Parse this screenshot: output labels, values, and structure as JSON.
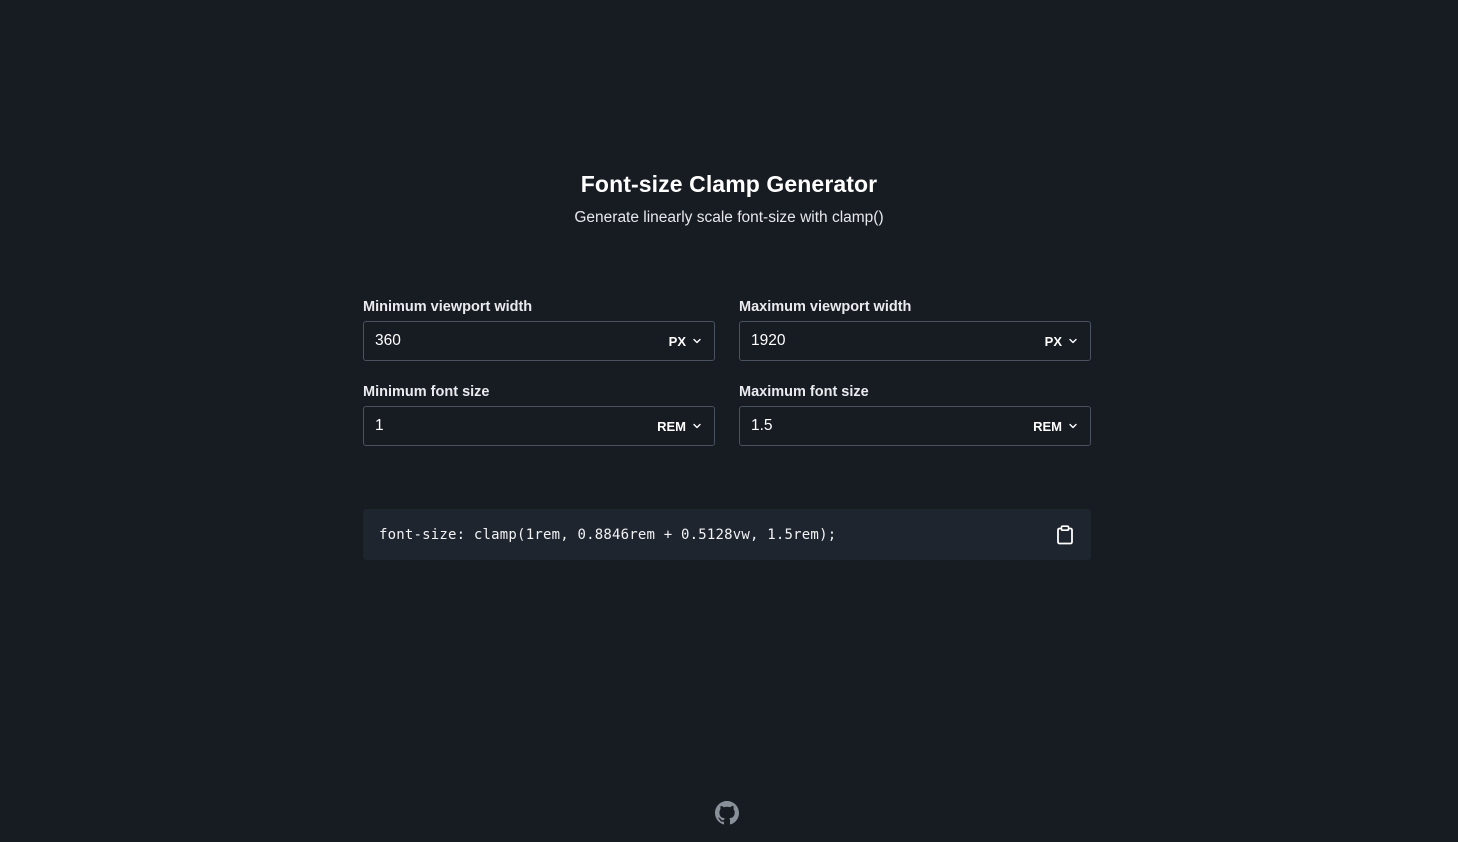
{
  "header": {
    "title": "Font-size Clamp Generator",
    "subtitle": "Generate linearly scale font-size with clamp()"
  },
  "fields": {
    "min_viewport": {
      "label": "Minimum viewport width",
      "value": "360",
      "unit": "PX"
    },
    "max_viewport": {
      "label": "Maximum viewport width",
      "value": "1920",
      "unit": "PX"
    },
    "min_font": {
      "label": "Minimum font size",
      "value": "1",
      "unit": "REM"
    },
    "max_font": {
      "label": "Maximum font size",
      "value": "1.5",
      "unit": "REM"
    }
  },
  "output": {
    "code": "font-size: clamp(1rem, 0.8846rem + 0.5128vw, 1.5rem);",
    "copy_icon": "clipboard-icon"
  },
  "footer": {
    "icon": "github-icon"
  },
  "colors": {
    "background": "#171b22",
    "output_background": "#1f252e",
    "border": "#4a5260",
    "text": "#ffffff"
  }
}
